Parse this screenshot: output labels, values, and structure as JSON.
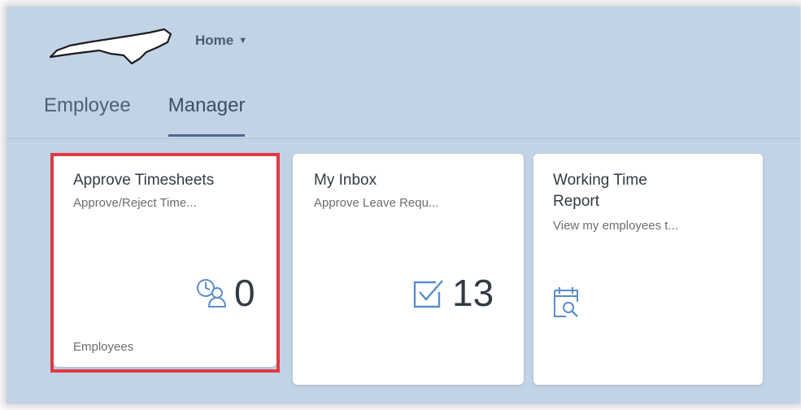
{
  "shell": {
    "home_label": "Home",
    "home_caret": "▼",
    "logo_icon": "state-outline-logo"
  },
  "tabs": [
    {
      "label": "Employee",
      "selected": false
    },
    {
      "label": "Manager",
      "selected": true
    }
  ],
  "tiles": [
    {
      "title": "Approve Timesheets",
      "subtitle": "Approve/Reject Time...",
      "number": "0",
      "icon": "timesheet-employee-icon",
      "footer": "Employees",
      "highlighted": true
    },
    {
      "title": "My Inbox",
      "subtitle": "Approve Leave Requ...",
      "number": "13",
      "icon": "checkbox-inbox-icon",
      "footer": ""
    },
    {
      "title_line1": "Working Time",
      "title_line2": "Report",
      "subtitle": "View my employees t...",
      "icon": "calendar-search-icon"
    }
  ],
  "colors": {
    "background": "#c3d3e6",
    "highlight": "#dc3b45",
    "icon_blue": "#5b8dc9"
  }
}
